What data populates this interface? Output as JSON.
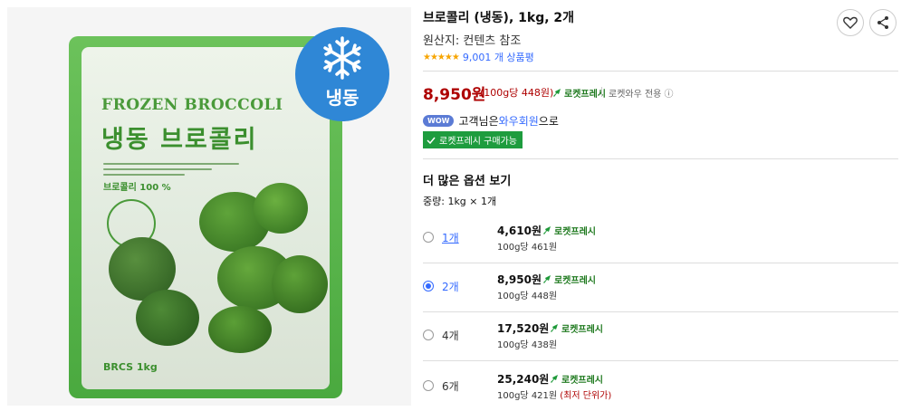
{
  "product": {
    "title": "브로콜리 (냉동), 1kg, 2개",
    "origin": "원산지: 컨텐츠 참조",
    "stars": "★★★★★",
    "rating_value": 5,
    "review_count": "9,001 개 상품평"
  },
  "image": {
    "brand_en": "FROZEN BROCCOLI",
    "brand_ko": "냉동 브로콜리",
    "percent": "브로콜리 100 %",
    "badge_text": "냉동",
    "footer": "BRCS  1kg"
  },
  "price": {
    "main": "8,950원",
    "unit": "(100g당 448원)",
    "rocket": "로켓프레시",
    "wow_only": "로켓와우 전용 ⓘ"
  },
  "wow": {
    "badge": "WOW",
    "prefix": "고객님은 ",
    "link": "와우회원",
    "suffix": "으로"
  },
  "rocket_available": "로켓프레시 구매가능",
  "options": {
    "title": "더 많은 옵션 보기",
    "weight": "중량: 1kg × 1개",
    "items": [
      {
        "qty": "1개",
        "price": "4,610원",
        "rocket": "로켓프레시",
        "unit": "100g당 461원",
        "note": ""
      },
      {
        "qty": "2개",
        "price": "8,950원",
        "rocket": "로켓프레시",
        "unit": "100g당 448원",
        "note": ""
      },
      {
        "qty": "4개",
        "price": "17,520원",
        "rocket": "로켓프레시",
        "unit": "100g당 438원",
        "note": ""
      },
      {
        "qty": "6개",
        "price": "25,240원",
        "rocket": "로켓프레시",
        "unit": "100g당 421원",
        "note": " (최저 단위가)"
      }
    ],
    "selected_index": 1
  },
  "colors": {
    "price_red": "#ae0000",
    "link_blue": "#346aff",
    "rocket_green": "#1e9c3e",
    "star_orange": "#f7a500"
  },
  "icons": [
    "heart-icon",
    "share-icon",
    "rocket-icon",
    "check-icon",
    "snowflake-icon"
  ]
}
